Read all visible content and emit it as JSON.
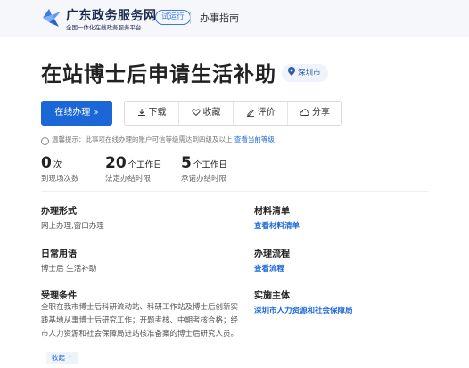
{
  "header": {
    "brand_title": "广东政务服务网",
    "brand_subtitle": "全国一体化在线政务服务平台",
    "trial_badge": "试运行",
    "nav_label": "办事指南"
  },
  "page": {
    "title": "在站博士后申请生活补助",
    "location": "深圳市"
  },
  "actions": {
    "apply_online": "在线办理 »",
    "download": "下载",
    "favorite": "收藏",
    "review": "评价",
    "share": "分享"
  },
  "notice": {
    "text": "温馨提示：此事项在线办理的账户可信等级需达到四级及以上",
    "link": "查看当前等级"
  },
  "stats": [
    {
      "num": "0",
      "unit": "次",
      "label": "到现场次数"
    },
    {
      "num": "20",
      "unit": "个工作日",
      "label": "法定办结时限"
    },
    {
      "num": "5",
      "unit": "个工作日",
      "label": "承诺办结时限"
    }
  ],
  "fields": {
    "handle_form": {
      "key": "办理形式",
      "value": "网上办理,窗口办理"
    },
    "materials": {
      "key": "材料清单",
      "value": "查看材料清单"
    },
    "common_terms": {
      "key": "日常用语",
      "value": "博士后 生活补助"
    },
    "process": {
      "key": "办理流程",
      "value": "查看流程"
    },
    "conditions": {
      "key": "受理条件",
      "value": "全职在我市博士后科研流动站、科研工作站及博士后创新实践基地从事博士后研究工作；开题考核、中期考核合格；经市人力资源和社会保障局进站核准备案的博士后研究人员。"
    },
    "agency": {
      "key": "实施主体",
      "value": "深圳市人力资源和社会保障局"
    }
  },
  "collapse_label": "收起 ⌃"
}
